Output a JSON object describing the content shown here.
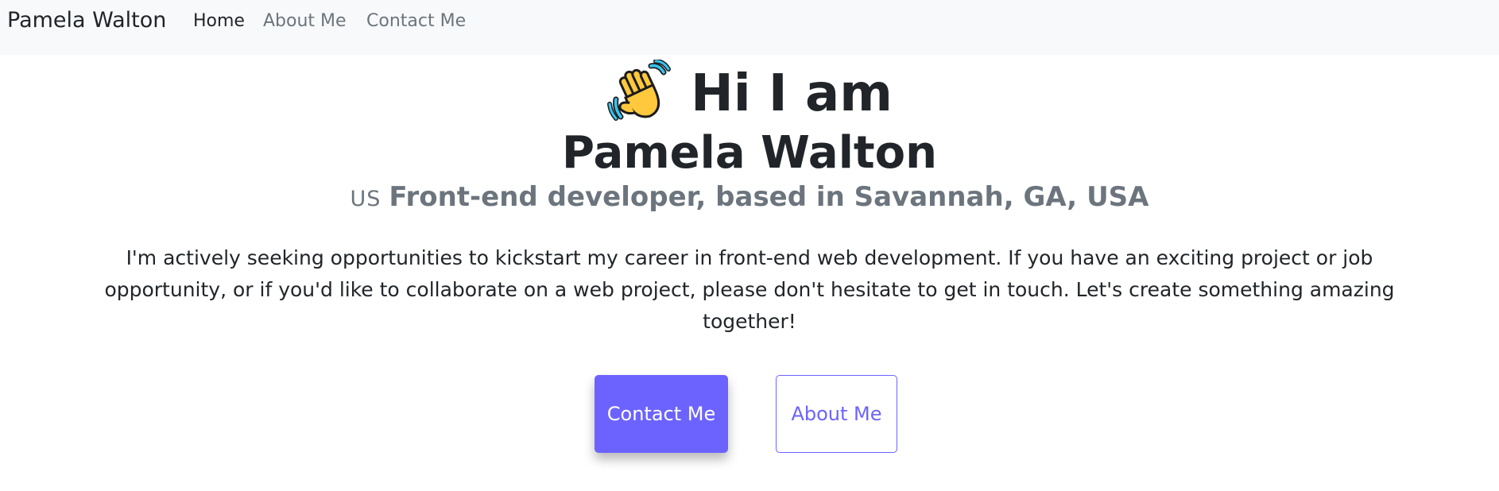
{
  "navbar": {
    "brand": "Pamela Walton",
    "links": [
      {
        "label": "Home",
        "active": true
      },
      {
        "label": "About Me",
        "active": false
      },
      {
        "label": "Contact Me",
        "active": false
      }
    ]
  },
  "hero": {
    "wave_icon": "waving-hand-icon",
    "greeting": "Hi I am",
    "name": "Pamela Walton",
    "flag_code": "US",
    "role": "Front-end developer, based in Savannah, GA, USA",
    "intro": "I'm actively seeking opportunities to kickstart my career in front-end web development. If you have an exciting project or job opportunity, or if you'd like to collaborate on a web project, please don't hesitate to get in touch. Let's create something amazing together!"
  },
  "actions": {
    "contact_label": "Contact Me",
    "about_label": "About Me"
  },
  "colors": {
    "accent": "#6c63ff",
    "navbar_bg": "#f8f9fa",
    "muted_text": "#6c757d",
    "dark_text": "#212529"
  }
}
